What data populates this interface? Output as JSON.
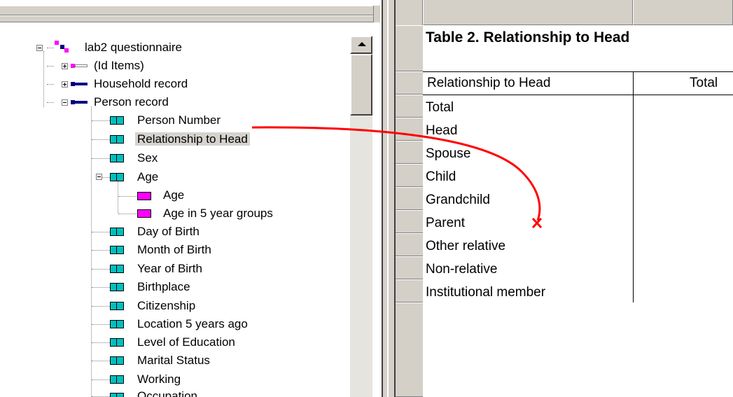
{
  "tree": {
    "root": {
      "label": "lab2 questionnaire"
    },
    "records": [
      {
        "label": "(Id Items)",
        "type": "id"
      },
      {
        "label": "Household record",
        "type": "record"
      },
      {
        "label": "Person record",
        "type": "record"
      }
    ],
    "items": [
      {
        "label": "Person Number"
      },
      {
        "label": "Relationship to Head",
        "selected": true
      },
      {
        "label": "Sex"
      },
      {
        "label": "Age",
        "expanded": true
      },
      {
        "label": "Age",
        "subitem": true
      },
      {
        "label": "Age in 5 year groups",
        "subitem": true
      },
      {
        "label": "Day of Birth"
      },
      {
        "label": "Month of Birth"
      },
      {
        "label": "Year of Birth"
      },
      {
        "label": "Birthplace"
      },
      {
        "label": "Citizenship"
      },
      {
        "label": "Location 5 years ago"
      },
      {
        "label": "Level of Education"
      },
      {
        "label": "Marital Status"
      },
      {
        "label": "Working"
      },
      {
        "label": "Occupation"
      }
    ]
  },
  "table": {
    "title": "Table 2. Relationship to Head",
    "column_headers": [
      "Relationship to Head",
      "Total"
    ],
    "rows": [
      "Total",
      "Head",
      "Spouse",
      "Child",
      "Grandchild",
      "Parent",
      "Other relative",
      "Non-relative",
      "Institutional member"
    ]
  },
  "annotation": {
    "color": "#ff0000",
    "drop_marker": "x"
  }
}
